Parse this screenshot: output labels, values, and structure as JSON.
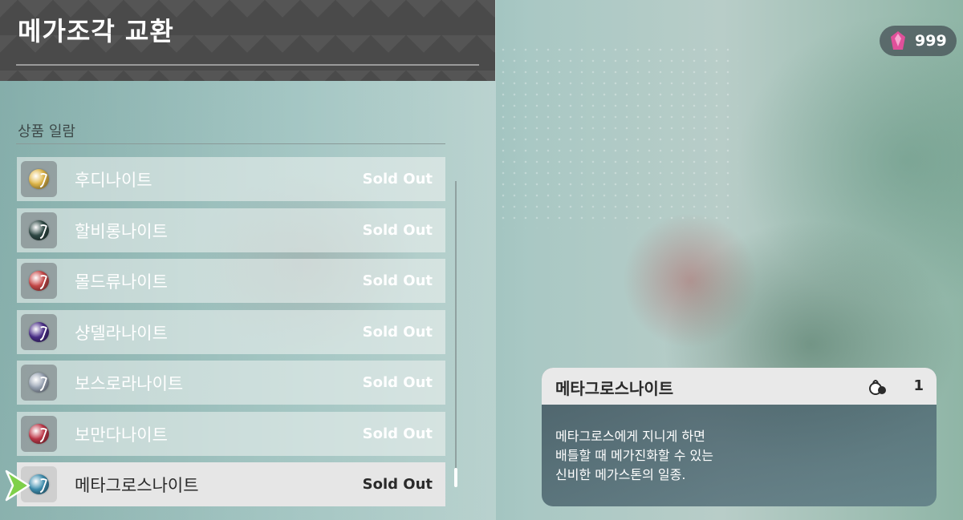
{
  "header": {
    "title": "메가조각 교환"
  },
  "list": {
    "section_title": "상품 일람",
    "items": [
      {
        "name": "후디나이트",
        "status": "Sold Out",
        "orb_color": "#e2b94a"
      },
      {
        "name": "할비롱나이트",
        "status": "Sold Out",
        "orb_color": "#2f4a46"
      },
      {
        "name": "몰드류나이트",
        "status": "Sold Out",
        "orb_color": "#c94a4a"
      },
      {
        "name": "샹델라나이트",
        "status": "Sold Out",
        "orb_color": "#4b2f8a"
      },
      {
        "name": "보스로라나이트",
        "status": "Sold Out",
        "orb_color": "#9aa5b5"
      },
      {
        "name": "보만다나이트",
        "status": "Sold Out",
        "orb_color": "#c0394a"
      },
      {
        "name": "메타그로스나이트",
        "status": "Sold Out",
        "orb_color": "#3f8fb0"
      }
    ],
    "selected_index": 6
  },
  "currency": {
    "icon": "mega-shard-icon",
    "value": "999",
    "color": "#e0509a"
  },
  "detail": {
    "name": "메타그로스나이트",
    "bag_icon": "bag-icon",
    "count": "1",
    "description": [
      "메타그로스에게 지니게 하면",
      "배틀할 때 메가진화할 수 있는",
      "신비한 메가스톤의 일종."
    ]
  },
  "colors": {
    "cursor": "#7fd04a",
    "header_bg": "#4a4a4a"
  }
}
